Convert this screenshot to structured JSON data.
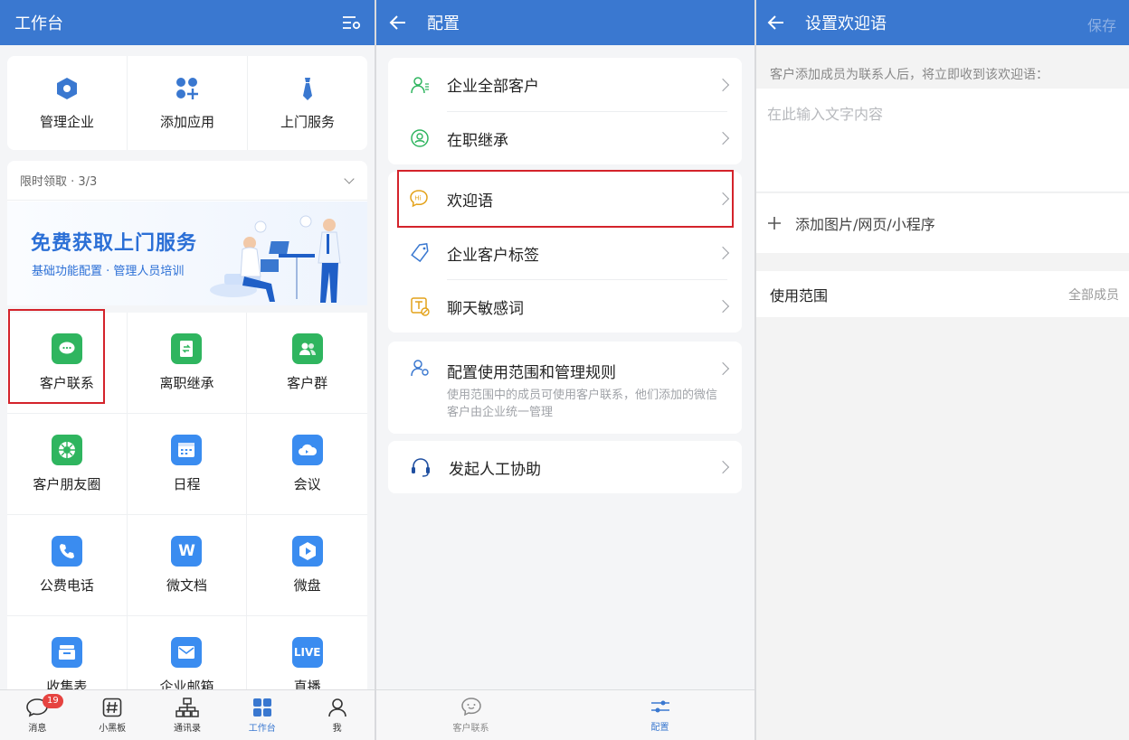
{
  "panel1": {
    "header": {
      "title": "工作台"
    },
    "top_actions": [
      "管理企业",
      "添加应用",
      "上门服务"
    ],
    "promo": {
      "section_label": "限时领取 · 3/3",
      "headline": "免费获取上门服务",
      "subline": "基础功能配置 · 管理人员培训"
    },
    "apps": [
      "客户联系",
      "离职继承",
      "客户群",
      "客户朋友圈",
      "日程",
      "会议",
      "公费电话",
      "微文档",
      "微盘",
      "收集表",
      "企业邮箱",
      "直播"
    ],
    "app_icon_text": {
      "weidoc": "W",
      "live": "LIVE"
    },
    "tabbar": {
      "tabs": [
        "消息",
        "小黑板",
        "通讯录",
        "工作台",
        "我"
      ],
      "badge": "19"
    }
  },
  "panel2": {
    "header": {
      "title": "配置"
    },
    "group1": [
      "企业全部客户",
      "在职继承"
    ],
    "group2": [
      "欢迎语",
      "企业客户标签",
      "聊天敏感词"
    ],
    "group3": {
      "title": "配置使用范围和管理规则",
      "desc": "使用范围中的成员可使用客户联系，他们添加的微信客户由企业统一管理"
    },
    "group4": [
      "发起人工协助"
    ],
    "tabbar": {
      "tabs": [
        "客户联系",
        "配置"
      ]
    }
  },
  "panel3": {
    "header": {
      "title": "设置欢迎语",
      "save": "保存"
    },
    "hint": "客户添加成员为联系人后，将立即收到该欢迎语：",
    "input_placeholder": "在此输入文字内容",
    "add_media": "添加图片/网页/小程序",
    "scope": {
      "label": "使用范围",
      "value": "全部成员"
    }
  },
  "colors": {
    "brand_blue": "#3a78d0",
    "green": "#2fb55f",
    "highlight_red": "#d4232b",
    "badge_red": "#e64340"
  }
}
